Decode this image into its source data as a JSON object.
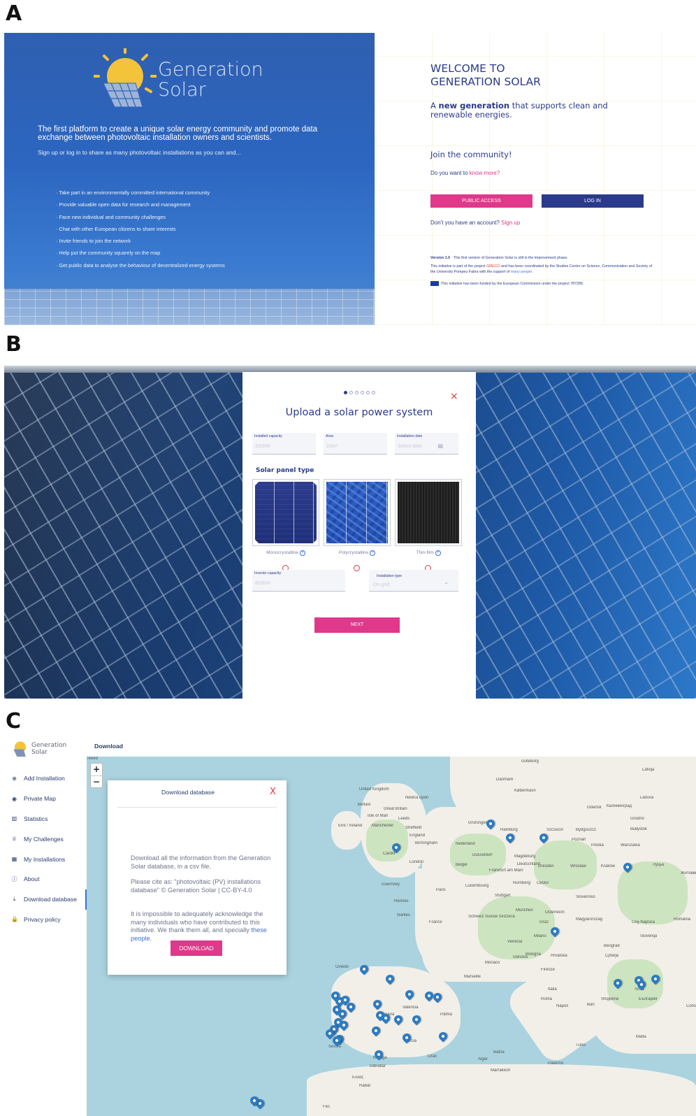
{
  "panels": {
    "a": "A",
    "b": "B",
    "c": "C"
  },
  "colors": {
    "brand_blue": "#2b3b8a",
    "accent_pink": "#e0388a",
    "close_red": "#e03a3a",
    "link_blue": "#3b6fd8",
    "sea": "#aad3df"
  },
  "landing": {
    "logo_line1": "Generation",
    "logo_line2": "Solar",
    "intro": "The first platform to create a unique solar energy community and promote data exchange between photovoltaic installation owners and scientists.",
    "sub": "Sign up or log in to share as many photovoltaic installations as you can and...",
    "bullets": [
      "· Take part in an environmentally committed international community",
      "· Provide valuable open data for research and management",
      "· Face new individual and community challenges",
      "· Chat with other European citizens to share interests",
      "· Invite friends to join the network",
      "· Help put the community squarely on the map",
      "· Get public data to analyse the behaviour of decentralized energy systems"
    ],
    "welcome_line1": "WELCOME TO",
    "welcome_line2": "GENERATION SOLAR",
    "tagline_prefix": "A ",
    "tagline_bold": "new generation",
    "tagline_suffix": " that supports clean and renewable energies.",
    "join": "Join the community!",
    "know_prefix": "Do you want to ",
    "know_link": "know more?",
    "public_access": "PUBLIC ACCESS",
    "log_in": "LOG IN",
    "signup_prefix": "Don't you have an account? ",
    "signup_link": "Sign up",
    "version_bold": "Version 1.0",
    "version_text": " · This first version of Generation Solar is still in the improvement phase.",
    "initiative_1": "This initiative is part of the project ",
    "initiative_greco": "GRECO",
    "initiative_2": " and has been coordinated by the Studies Centre on Science, Communication and Society of the University Pompeu Fabra with the support of ",
    "initiative_link": "many people",
    "initiative_3": ".",
    "funded": "This initiative has been funded by the European Commission under the project 787289."
  },
  "upload": {
    "steps_total": 6,
    "step_active": 1,
    "close": "×",
    "title": "Upload a solar power system",
    "fields": {
      "capacity_label": "Installed capacity",
      "capacity_ph": "330kW",
      "area_label": "Area",
      "area_ph": "10m²",
      "date_label": "Installation date",
      "date_ph": "Select date",
      "inverter_label": "Inverter capacity",
      "inverter_ph": "800kW",
      "type_label": "Installation type",
      "type_ph": "On-grid"
    },
    "panel_type_title": "Solar panel type",
    "panel_types": [
      "Monocrystalline",
      "Polycrystalline",
      "Thin-film"
    ],
    "help": "?",
    "next": "NEXT"
  },
  "dashboard": {
    "logo_line1": "Generation",
    "logo_line2": "Solar",
    "breadcrumb": "Download",
    "menu": [
      {
        "label": "Add Installation",
        "icon": "⊕"
      },
      {
        "label": "Private Map",
        "icon": "◉"
      },
      {
        "label": "Statistics",
        "icon": "▥"
      },
      {
        "label": "My Challenges",
        "icon": "♕"
      },
      {
        "label": "My Installations",
        "icon": "▦"
      },
      {
        "label": "About",
        "icon": "ⓘ"
      },
      {
        "label": "Download database",
        "icon": "⤓"
      },
      {
        "label": "Privacy policy",
        "icon": "🔒"
      }
    ],
    "zoom_in": "+",
    "zoom_out": "−",
    "download_modal": {
      "title": "Download database",
      "close": "X",
      "p1": "Download all the information from the Generation Solar database, in a csv file.",
      "p2": "Please cite as: \"photovoltaic (PV) installations database\" © Generation Solar | CC-BY-4.0",
      "p3_prefix": "It is impossible to adequately acknowledge the many individuals who have contributed to this initiative. We thank them all, and specially ",
      "p3_link": "these people",
      "p3_suffix": ".",
      "button": "DOWNLOAD"
    },
    "map_labels": [
      "Göteborg",
      "Latvija",
      "Danmark",
      "København",
      "Lietuva",
      "United Kingdom",
      "Newca upon",
      "Belfast",
      "Great Britain",
      "Isle of Man",
      "Gdańsk",
      "Калининград",
      "Éire / Ireland",
      "Manchester",
      "Leeds",
      "Sheffield",
      "Groningen",
      "Hamburg",
      "Szczecin",
      "Bydgoszcz",
      "Grodno",
      "Białystok",
      "England",
      "Birmingham",
      "Nederland",
      "Poznań",
      "Polska",
      "Warszawa",
      "Cardiff",
      "London",
      "Düsseldorf",
      "Magdeburg",
      "Deutschland",
      "Dresden",
      "Wrocław",
      "Kraków",
      "Луцьк",
      "Житоми",
      "België",
      "Frankfurt am Main",
      "Česko",
      "Slovensko",
      "Guernsey",
      "Paris",
      "Nürnberg",
      "Luxembourg",
      "Stuttgart",
      "München",
      "Österreich",
      "Rennes",
      "Nantes",
      "France",
      "Schweiz Suisse Svizzera",
      "Graz",
      "Magyarország",
      "Cluj-Napoca",
      "România",
      "Slovenija",
      "Milano",
      "Venezia",
      "Bologna",
      "Hrvatska",
      "Beograd",
      "Србија",
      "Oviedo",
      "Monaco",
      "Genova",
      "Firenze",
      "Marseille",
      "Italia",
      "Roma",
      "Napoli",
      "Bari",
      "Shqipëria",
      "Sofia",
      "България",
      "España",
      "Valencia",
      "Palma",
      "Murcia",
      "Sevilla",
      "Málaga",
      "Gibraltar",
      "Oran",
      "Alger",
      "Tunis",
      "Palermo",
      "Malta",
      "Ελλάς",
      "Rabat",
      "Fès",
      "Marrakech",
      "Batna",
      "Constantine",
      "Tekird"
    ]
  }
}
